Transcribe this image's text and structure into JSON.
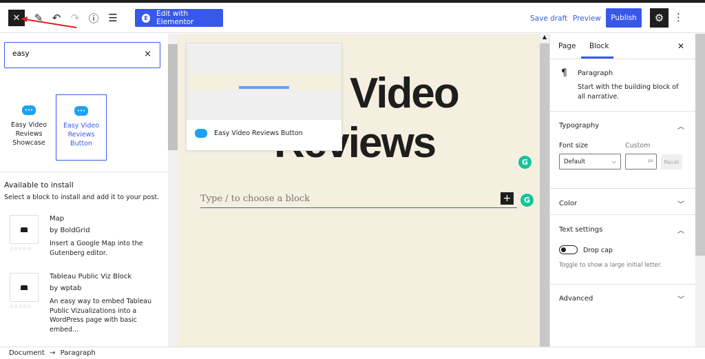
{
  "toolbar": {
    "close_icon": "close-icon",
    "edit_with_elementor": "Edit with Elementor",
    "save_draft": "Save draft",
    "preview": "Preview",
    "publish": "Publish",
    "accent": "#3858e9"
  },
  "inserter": {
    "search_value": "easy",
    "search_clear": "×",
    "results": [
      {
        "label": "Easy Video Reviews Showcase",
        "selected": false
      },
      {
        "label": "Easy Video Reviews Button",
        "selected": true
      }
    ],
    "available_title": "Available to install",
    "available_sub": "Select a block to install and add it to your post.",
    "plugins": [
      {
        "name": "Map",
        "author": "by BoldGrid",
        "description": "Insert a Google Map into the Gutenberg editor.",
        "rating": 0
      },
      {
        "name": "Tableau Public Viz Block",
        "author": "by wptab",
        "description": "An easy way to embed Tableau Public Vizualizations into a WordPress page with basic embed...",
        "rating": 0
      }
    ]
  },
  "canvas": {
    "heading_line1": "Video",
    "heading_line2": "Reviews",
    "paragraph_placeholder": "Type / to choose a block",
    "preview_label": "Easy Video Reviews Button"
  },
  "sidebar": {
    "tabs": [
      "Page",
      "Block"
    ],
    "active_tab": "Block",
    "block_name": "Paragraph",
    "block_desc": "Start with the building block of all narrative.",
    "typography": "Typography",
    "font_size_label": "Font size",
    "custom_label": "Custom",
    "font_size_value": "Default",
    "custom_unit": "px",
    "reset": "Reset",
    "color": "Color",
    "text_settings": "Text settings",
    "drop_cap": "Drop cap",
    "drop_cap_on": false,
    "drop_cap_help": "Toggle to show a large initial letter.",
    "advanced": "Advanced"
  },
  "footer": {
    "crumb1": "Document",
    "sep": "→",
    "crumb2": "Paragraph"
  }
}
